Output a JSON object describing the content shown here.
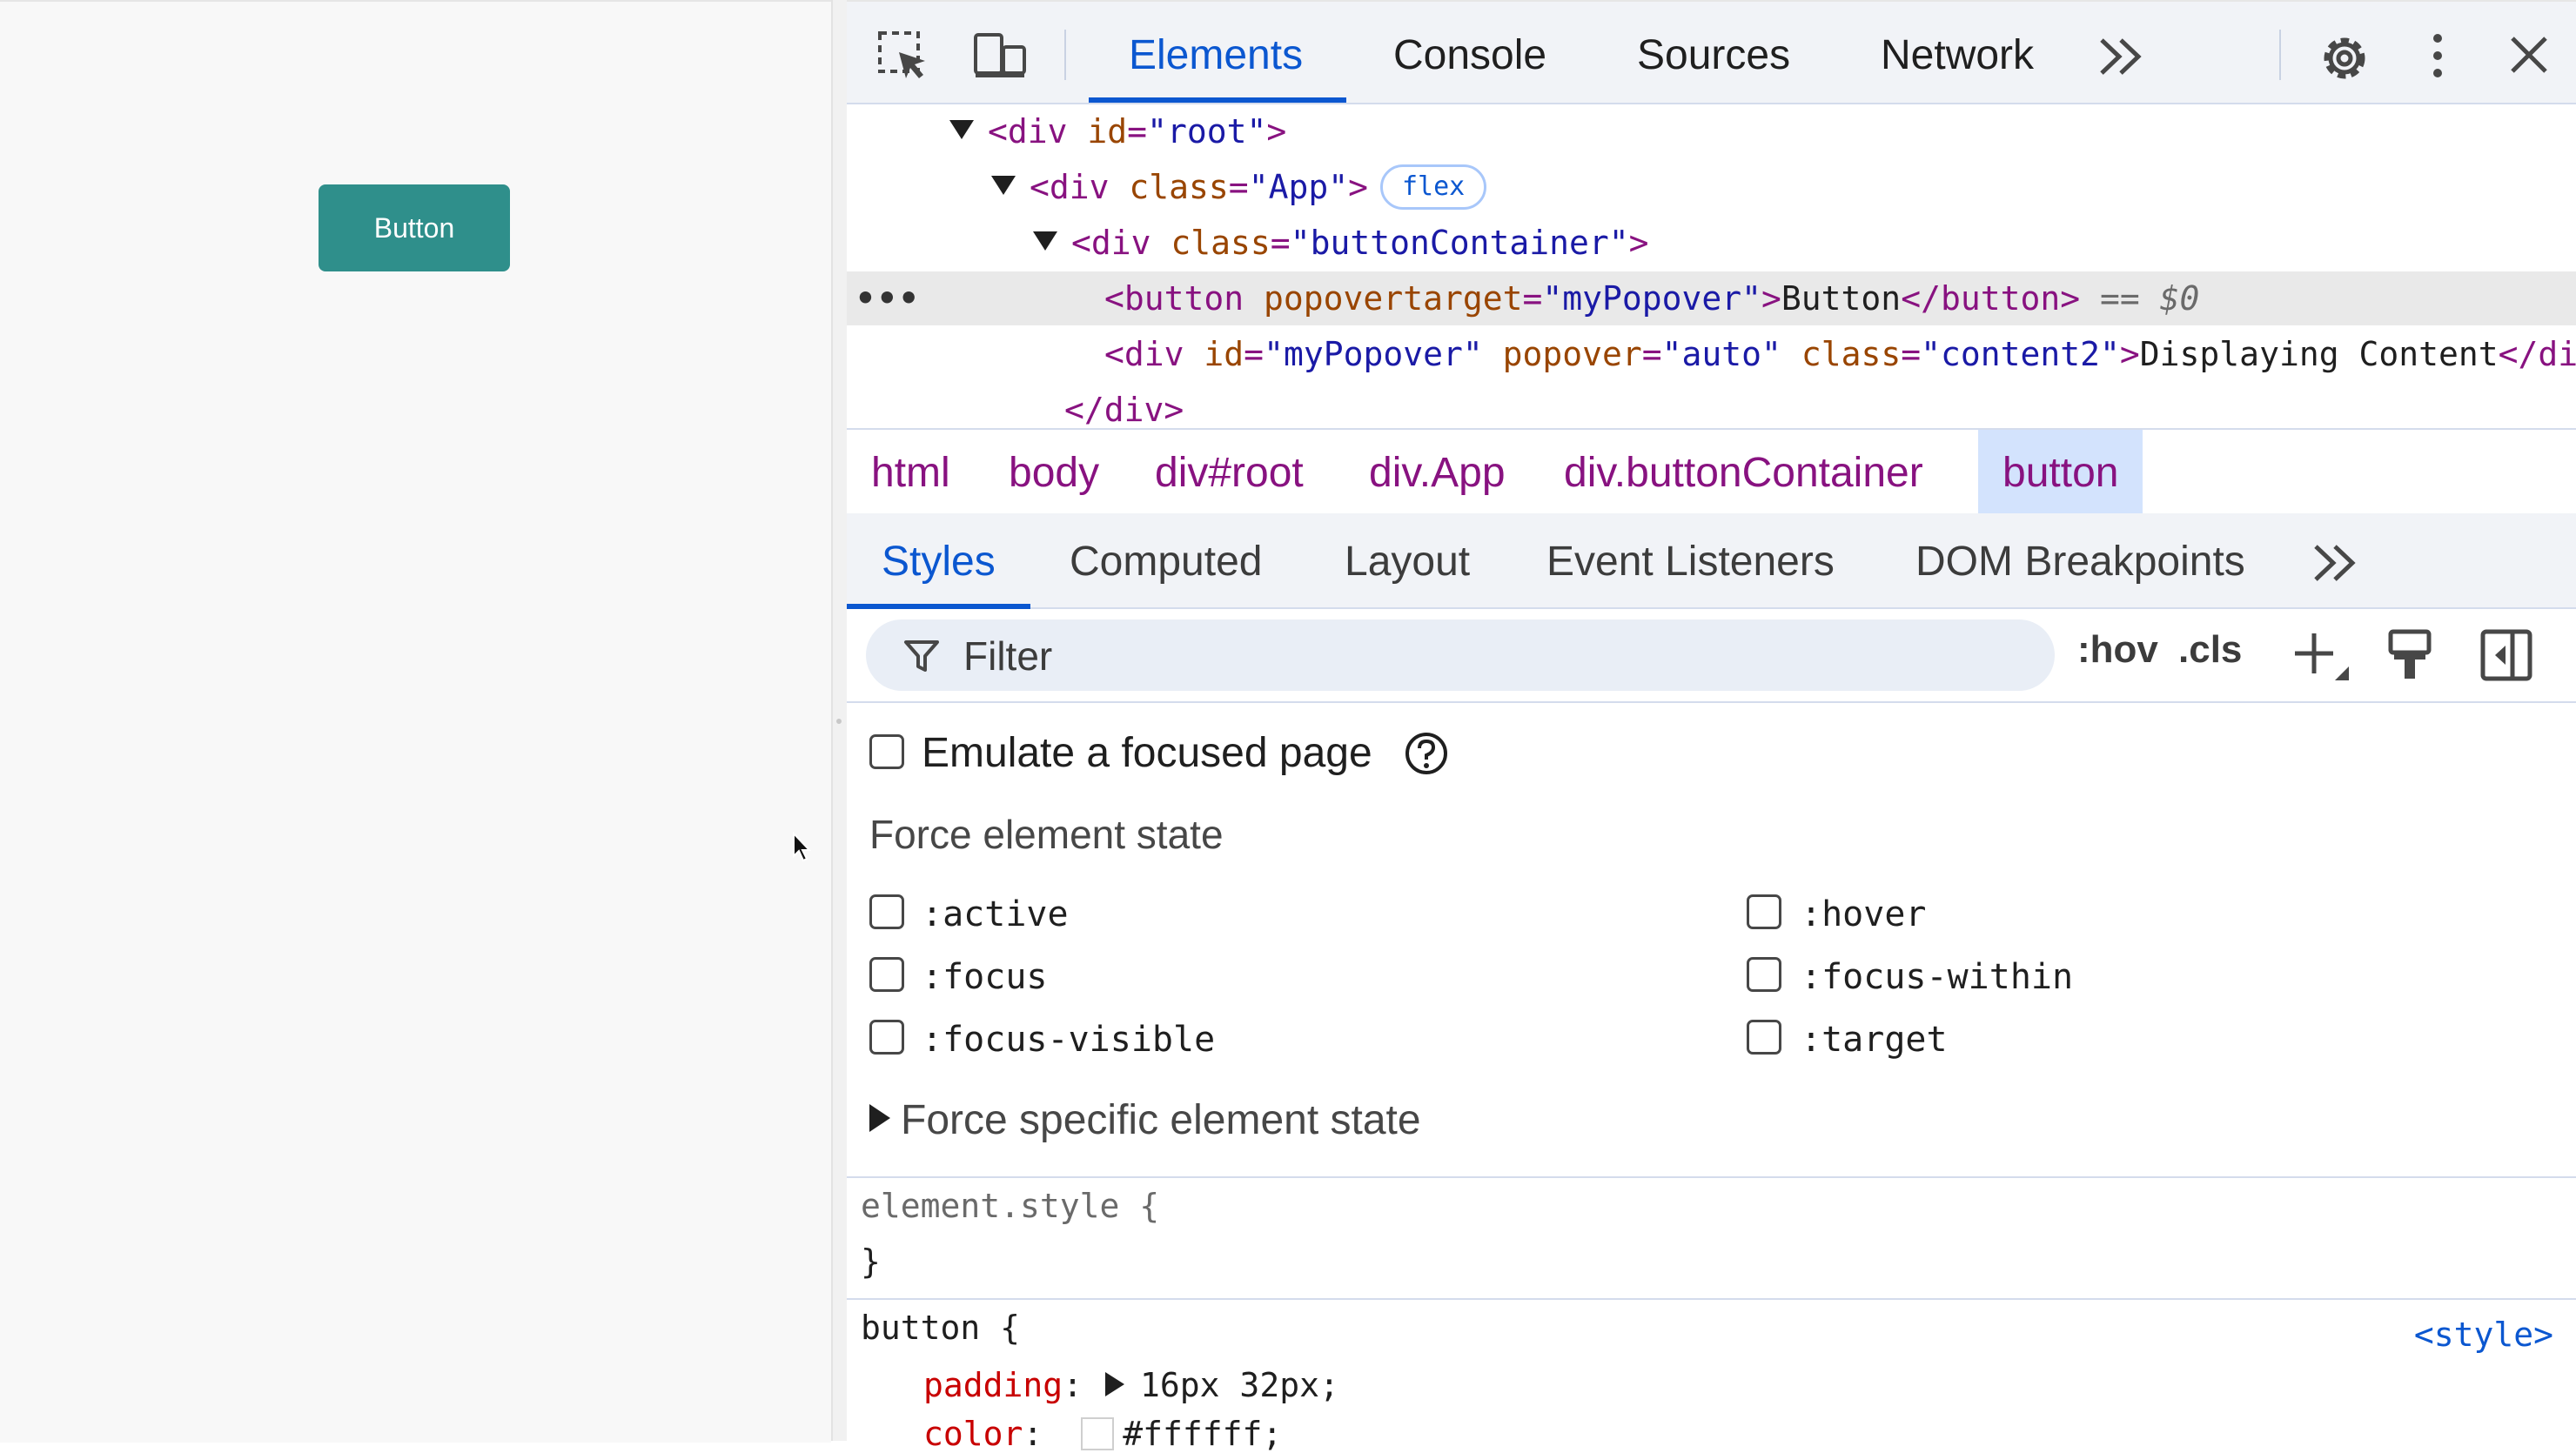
{
  "page": {
    "button_label": "Button"
  },
  "toolbar": {
    "tabs": [
      "Elements",
      "Console",
      "Sources",
      "Network"
    ],
    "active_tab": "Elements",
    "more_tabs_icon": "chevron-double-right-icon",
    "icons": [
      "inspect-element-icon",
      "device-toolbar-icon",
      "gear-icon",
      "more-vertical-icon",
      "close-icon"
    ]
  },
  "dom": {
    "line1": {
      "open": "<div",
      "attr": "id",
      "eq": "=",
      "value": "\"root\"",
      "close": ">"
    },
    "line2": {
      "open": "<div",
      "attr": "class",
      "eq": "=",
      "value": "\"App\"",
      "close": ">",
      "badge": "flex"
    },
    "line3": {
      "open": "<div",
      "attr": "class",
      "eq": "=",
      "value": "\"buttonContainer\"",
      "close": ">"
    },
    "line4": {
      "open": "<button",
      "attr": "popovertarget",
      "eq": "=",
      "value": "\"myPopover\"",
      "close": ">",
      "text": "Button",
      "end": "</button>",
      "marker": "== $0",
      "ellipsis": "•••"
    },
    "line5": {
      "open": "<div",
      "attr1": "id",
      "value1": "\"myPopover\"",
      "attr2": "popover",
      "value2": "\"auto\"",
      "attr3": "class",
      "value3": "\"content2\"",
      "eq": "=",
      "close": ">",
      "text": "Displaying Content",
      "end": "</div>"
    },
    "line6": {
      "end": "</div>"
    }
  },
  "breadcrumb": [
    "html",
    "body",
    "div#root",
    "div.App",
    "div.buttonContainer",
    "button"
  ],
  "subtabs": [
    "Styles",
    "Computed",
    "Layout",
    "Event Listeners",
    "DOM Breakpoints"
  ],
  "filter": {
    "placeholder": "Filter",
    "hov": ":hov",
    "cls": ".cls"
  },
  "state": {
    "emulate_label": "Emulate a focused page",
    "force_title": "Force element state",
    "left_states": [
      ":active",
      ":focus",
      ":focus-visible"
    ],
    "right_states": [
      ":hover",
      ":focus-within",
      ":target"
    ],
    "specific_label": "Force specific element state"
  },
  "rules": {
    "element_selector": "element.style {",
    "element_close": "}",
    "button_selector": "button {",
    "source": "<style>",
    "padding_prop": "padding",
    "padding_value": "16px 32px;",
    "color_prop": "color",
    "color_value": "#ffffff;"
  },
  "colors": {
    "accent": "#0b57d0",
    "page_button": "#2f8f8b",
    "tag": "#881280",
    "attr": "#994500",
    "value": "#1a1aa6"
  }
}
